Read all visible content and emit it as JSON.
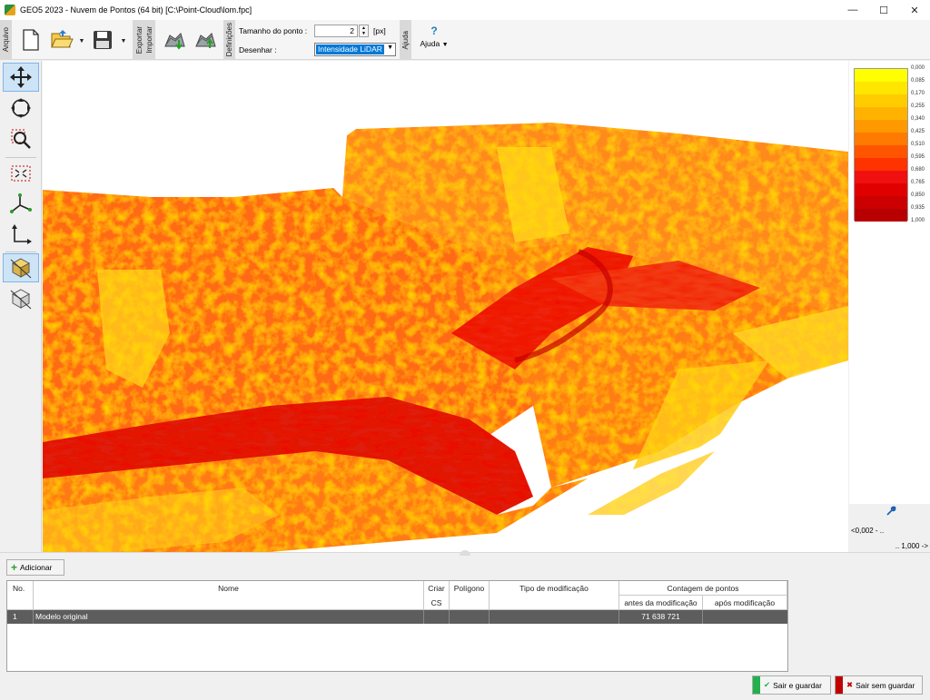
{
  "window": {
    "title": "GEO5 2023 - Nuvem de Pontos (64 bit) [C:\\Point-Cloud\\lom.fpc]",
    "minimize": "—",
    "maximize": "☐",
    "close": "✕"
  },
  "toolbar": {
    "tab_arquivo": "Arquivo",
    "tab_importar": "Importar",
    "tab_exportar": "Exportar",
    "tab_definicoes": "Definições",
    "tab_ajuda": "Ajuda",
    "point_size_label": "Tamanho do ponto :",
    "point_size_value": "2",
    "point_size_unit": "[px]",
    "draw_label": "Desenhar :",
    "draw_value": "Intensidade LiDAR",
    "help_label": "Ajuda"
  },
  "legend": {
    "colors": [
      "#ffff00",
      "#ffe600",
      "#ffcc00",
      "#ffb300",
      "#ff9900",
      "#ff7a00",
      "#ff5500",
      "#ff3300",
      "#f01010",
      "#e00000",
      "#cc0000",
      "#b80000"
    ],
    "labels": [
      "0,000",
      "0,085",
      "0,170",
      "0,255",
      "0,340",
      "0,425",
      "0,510",
      "0,595",
      "0,680",
      "0,765",
      "0,850",
      "0,935",
      "1,000"
    ],
    "range_min": "<0,002 - ..",
    "range_max": ".. 1,000 ->"
  },
  "bottom": {
    "add_label": "Adicionar",
    "columns": {
      "no": "No.",
      "nome": "Nome",
      "criar": "Criar",
      "cs": "CS",
      "poligono": "Polígono",
      "tipo": "Tipo de modificação",
      "contagem": "Contagem de pontos",
      "antes": "antes da modificação",
      "apos": "após modificação"
    },
    "rows": [
      {
        "no": "1",
        "nome": "Modelo original",
        "antes": "71 638 721",
        "apos": ""
      }
    ],
    "save_exit": "Sair e guardar",
    "exit_nosave": "Sair sem guardar"
  },
  "colors": {
    "selection": "#0078d7",
    "active_tool": "#cde4f7",
    "row_selected": "#5d5d5d"
  }
}
